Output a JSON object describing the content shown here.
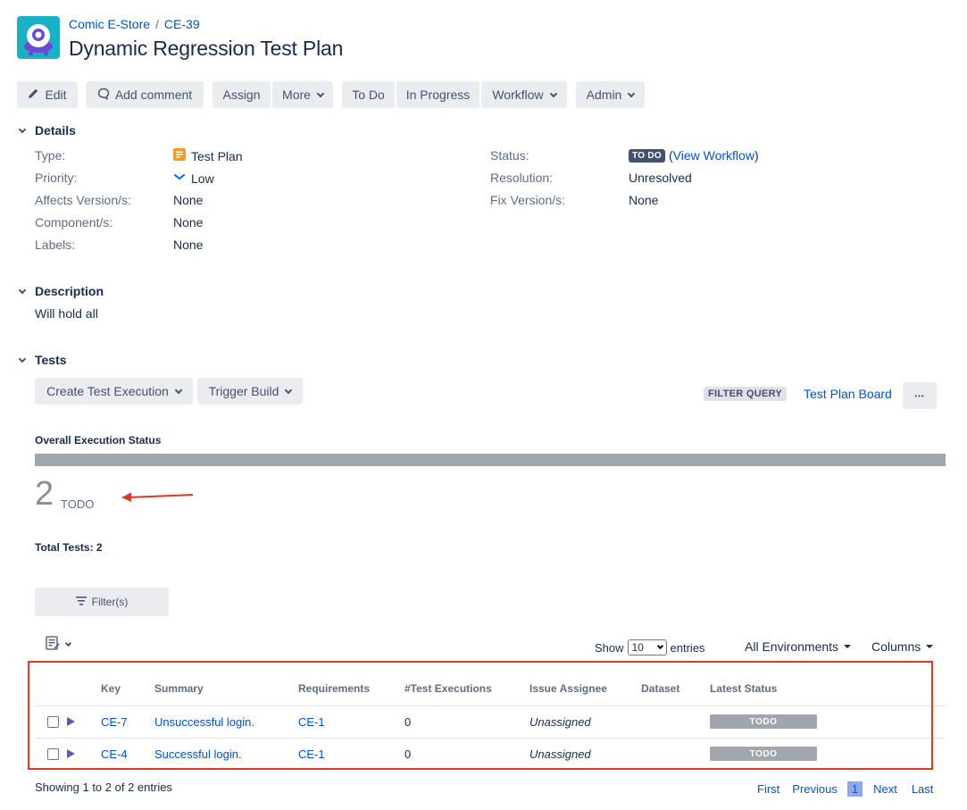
{
  "breadcrumb": {
    "project": "Comic E-Store",
    "separator": "/",
    "issue_key": "CE-39"
  },
  "title": "Dynamic Regression Test Plan",
  "toolbar": {
    "edit": "Edit",
    "add_comment": "Add comment",
    "assign": "Assign",
    "more": "More",
    "to_do": "To Do",
    "in_progress": "In Progress",
    "workflow": "Workflow",
    "admin": "Admin"
  },
  "details": {
    "heading": "Details",
    "type_label": "Type:",
    "type_value": "Test Plan",
    "priority_label": "Priority:",
    "priority_value": "Low",
    "affects_label": "Affects Version/s:",
    "affects_value": "None",
    "component_label": "Component/s:",
    "component_value": "None",
    "labels_label": "Labels:",
    "labels_value": "None",
    "status_label": "Status:",
    "status_value": "TO DO",
    "view_workflow_open": "(",
    "view_workflow": "View Workflow",
    "view_workflow_close": ")",
    "resolution_label": "Resolution:",
    "resolution_value": "Unresolved",
    "fix_label": "Fix Version/s:",
    "fix_value": "None"
  },
  "description": {
    "heading": "Description",
    "text": "Will hold all"
  },
  "tests": {
    "heading": "Tests",
    "create_execution": "Create Test Execution",
    "trigger_build": "Trigger Build",
    "filter_query": "FILTER QUERY",
    "board_link": "Test Plan Board",
    "more_dots": "•••",
    "overall_heading": "Overall Execution Status",
    "count": "2",
    "count_label": "TODO",
    "progress": {
      "todo_fraction": 1.0
    },
    "total_tests": "Total Tests: 2",
    "filters_button": "Filter(s)",
    "show_label": "Show",
    "entries_value": "10",
    "entries_label": "entries",
    "environments": "All Environments",
    "columns": "Columns"
  },
  "table": {
    "headers": [
      "Key",
      "Summary",
      "Requirements",
      "#Test Executions",
      "Issue Assignee",
      "Dataset",
      "Latest Status"
    ],
    "rows": [
      {
        "key": "CE-7",
        "summary": "Unsuccessful login.",
        "requirements": "CE-1",
        "executions": "0",
        "assignee": "Unassigned",
        "dataset": "",
        "status": "TODO"
      },
      {
        "key": "CE-4",
        "summary": "Successful login.",
        "requirements": "CE-1",
        "executions": "0",
        "assignee": "Unassigned",
        "dataset": "",
        "status": "TODO"
      }
    ]
  },
  "footer": {
    "showing": "Showing 1 to 2 of 2 entries",
    "first": "First",
    "previous": "Previous",
    "page": "1",
    "next": "Next",
    "last": "Last"
  },
  "colors": {
    "annotation_red": "#e0391f",
    "status_gray": "#a1a5ad",
    "link_blue": "#0052cc",
    "test_icon": "#6554c0"
  },
  "icons": [
    "edit-icon",
    "comment-icon",
    "test-plan-icon",
    "priority-low-icon",
    "filter-icon",
    "list-settings-icon",
    "test-type-icon"
  ]
}
